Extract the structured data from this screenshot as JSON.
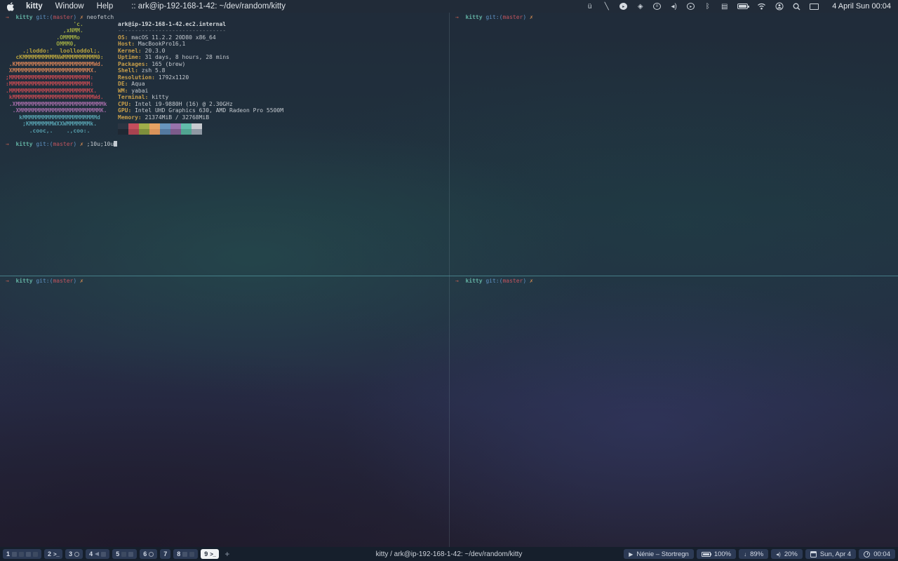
{
  "menu_bar": {
    "app_name": "kitty",
    "menus": [
      "Window",
      "Help"
    ],
    "window_title": ":: ark@ip-192-168-1-42: ~/dev/random/kitty",
    "status_icons": [
      "uebersicht",
      "wand",
      "telegram",
      "unity",
      "notunes",
      "volume",
      "music",
      "bluetooth",
      "input-source",
      "battery",
      "wifi",
      "user-switch",
      "spotlight",
      "display"
    ],
    "clock": "4 April Sun  00:04"
  },
  "terminal": {
    "prompt": {
      "arrow": "→  ",
      "cwd": "kitty ",
      "git_prefix": "git:(",
      "branch": "master",
      "git_suffix": ") ",
      "dirty": "✗ "
    },
    "top_left": {
      "command1": "neofetch",
      "command2": ";10u;10u"
    }
  },
  "neofetch": {
    "ascii": [
      "                    'c.",
      "                 ,xNMM.",
      "               .OMMMMo",
      "               OMMM0,",
      "     .;loddo:'  loolloddol;.",
      "   cKMMMMMMMMMMNWMMMMMMMMMM0:",
      " .KMMMMMMMMMMMMMMMMMMMMMMMWd.",
      " XMMMMMMMMMMMMMMMMMMMMMMMX.",
      ";MMMMMMMMMMMMMMMMMMMMMMMM:",
      ":MMMMMMMMMMMMMMMMMMMMMMMM:",
      ".MMMMMMMMMMMMMMMMMMMMMMMMX.",
      " kMMMMMMMMMMMMMMMMMMMMMMMMWd.",
      " .XMMMMMMMMMMMMMMMMMMMMMMMMMMk",
      "  .XMMMMMMMMMMMMMMMMMMMMMMMMK.",
      "    kMMMMMMMMMMMMMMMMMMMMMMd",
      "     ;KMMMMMMMWXXWMMMMMMMk.",
      "       .cooc,.    .,coo:."
    ],
    "title": "ark@ip-192-168-1-42.ec2.internal",
    "separator": "--------------------------------",
    "info": [
      {
        "label": "OS:",
        "value": "macOS 11.2.2 20D80 x86_64"
      },
      {
        "label": "Host:",
        "value": "MacBookPro16,1"
      },
      {
        "label": "Kernel:",
        "value": "20.3.0"
      },
      {
        "label": "Uptime:",
        "value": "31 days, 8 hours, 28 mins"
      },
      {
        "label": "Packages:",
        "value": "165 (brew)"
      },
      {
        "label": "Shell:",
        "value": "zsh 5.8"
      },
      {
        "label": "Resolution:",
        "value": "1792x1120"
      },
      {
        "label": "DE:",
        "value": "Aqua"
      },
      {
        "label": "WM:",
        "value": "yabai"
      },
      {
        "label": "Terminal:",
        "value": "kitty"
      },
      {
        "label": "CPU:",
        "value": "Intel i9-9880H (16) @ 2.30GHz"
      },
      {
        "label": "GPU:",
        "value": "Intel UHD Graphics 630, AMD Radeon Pro 5500M"
      },
      {
        "label": "Memory:",
        "value": "21374MiB / 32768MiB"
      }
    ],
    "palette_row1": [
      "#2b3542",
      "#c44e5c",
      "#9fae49",
      "#e5a263",
      "#6795bd",
      "#9873ab",
      "#62bcab",
      "#c7cbd0"
    ],
    "palette_row2": [
      "#1f2833",
      "#a84350",
      "#7e8f3c",
      "#d9935a",
      "#54799f",
      "#7c5b8b",
      "#51a491",
      "#8f98a3"
    ]
  },
  "status_bar": {
    "spaces": [
      {
        "num": "1"
      },
      {
        "num": "2",
        "term_label": ">_"
      },
      {
        "num": "3"
      },
      {
        "num": "4"
      },
      {
        "num": "5"
      },
      {
        "num": "6"
      },
      {
        "num": "7"
      },
      {
        "num": "8"
      },
      {
        "num": "9",
        "term_label": ">_"
      }
    ],
    "plus_label": "+",
    "window_title": "kitty / ark@ip-192-168-1-42: ~/dev/random/kitty",
    "segments": {
      "music": "Nénie – Stortregn",
      "battery": "100%",
      "indicator": "89%",
      "volume": "20%",
      "date": "Sun, Apr 4",
      "time": "00:04"
    }
  },
  "colors": {
    "accent_teal": "#62b0a2",
    "prompt_arrow": "#c05f50",
    "git_blue": "#5f93c4",
    "branch_red": "#c0545e",
    "dirty_orange": "#d08a52",
    "label_gold": "#c89f4a",
    "divider_teal": "#52969e",
    "chip_bg": "#2c3a55",
    "menubar_bg": "#212b38",
    "statusbar_bg": "#161f2c"
  }
}
